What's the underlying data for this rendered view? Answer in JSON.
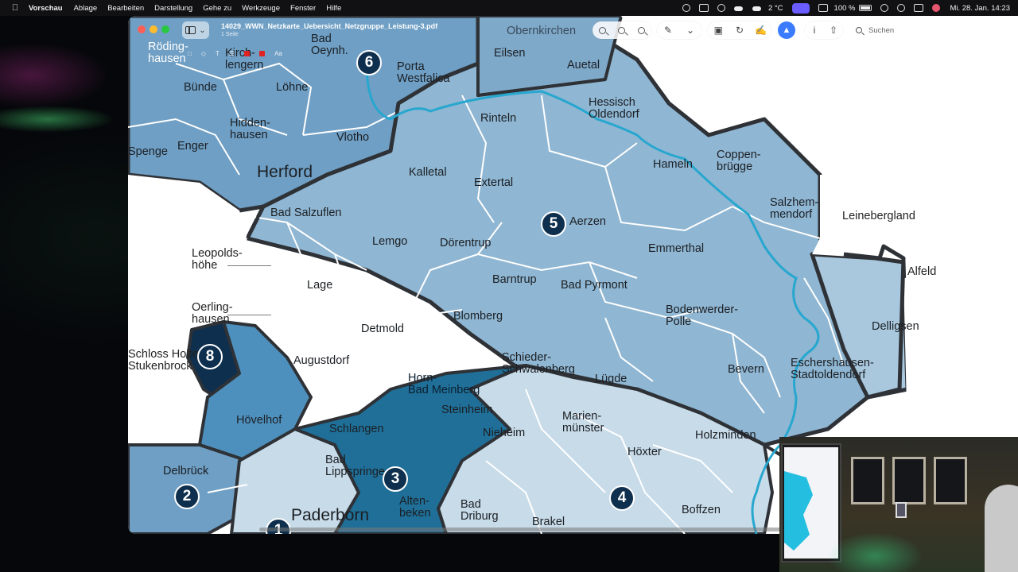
{
  "menubar": {
    "app_name": "Vorschau",
    "items": [
      "Ablage",
      "Bearbeiten",
      "Darstellung",
      "Gehe zu",
      "Werkzeuge",
      "Fenster",
      "Hilfe"
    ],
    "weather": "2 °C",
    "battery": "100 %",
    "datetime": "Mi. 28. Jan.  14:23"
  },
  "window": {
    "title": "14029_WWN_Netzkarte_Uebersicht_Netzgruppe_Leistung-3.pdf",
    "subtitle": "1 Seite",
    "search_placeholder": "Suchen",
    "mini_tool_label": "Aa"
  },
  "map": {
    "colors": {
      "group_light": "#c8dbe8",
      "group_mid": "#8fb6d2",
      "group_dark": "#6f9fc4",
      "group_deep": "#1f6f98",
      "group_navy": "#0e2f4d",
      "river": "#27a7cf",
      "border": "#2e3237"
    },
    "labels": {
      "radinghausen": "Röding-\nhausen",
      "kirchlengern": "Kirch-\nlengern",
      "bad_oeynhausen": "Bad\nOeynh.",
      "porta_westfalica": "Porta\nWestfalica",
      "eilsen": "Eilsen",
      "auetal": "Auetal",
      "obernkirchen": "Obernkirchen",
      "buende": "Bünde",
      "loehne": "Löhne",
      "hiddenhausen": "Hidden-\nhausen",
      "vlotho": "Vlotho",
      "rinteln": "Rinteln",
      "hessisch_oldendorf": "Hessisch\nOldendorf",
      "enger": "Enger",
      "spenge": "Spenge",
      "herford": "Herford",
      "kalletal": "Kalletal",
      "extertal": "Extertal",
      "hameln": "Hameln",
      "coppenbruegge": "Coppen-\nbrügge",
      "salzhemmendorf": "Salzhem-\nmendorf",
      "leinebergland": "Leinebergland",
      "bad_salzuflen": "Bad Salzuflen",
      "aerzen": "Aerzen",
      "lemgo": "Lemgo",
      "doerentrup": "Dörentrup",
      "emmerthal": "Emmerthal",
      "alfeld": "Alfeld",
      "leopoldshoehe": "Leopolds-\nhöhe",
      "lage": "Lage",
      "barntrup": "Barntrup",
      "bad_pyrmont": "Bad Pyrmont",
      "oerlinghausen": "Oerling-\nhausen",
      "detmold": "Detmold",
      "blomberg": "Blomberg",
      "bodenwerder": "Bodenwerder-\nPolle",
      "delligsen": "Delligsen",
      "schloss_holte": "Schloss Holte-\nStukenbrock",
      "augustdorf": "Augustdorf",
      "schieder": "Schieder-\nSchwalenberg",
      "luegde": "Lügde",
      "bevern": "Bevern",
      "eschershausen": "Eschershausen-\nStadtoldendorf",
      "horn": "Horn-\nBad Meinberg",
      "steinheim": "Steinheim",
      "hoevelhof": "Hövelhof",
      "schlangen": "Schlangen",
      "nieheim": "Nieheim",
      "marienmuenster": "Marien-\nmünster",
      "holzminden": "Holzminden",
      "hoexter": "Höxter",
      "bad_lippspringe": "Bad\nLippspringe",
      "delbrueck": "Delbrück",
      "paderborn": "Paderborn",
      "altenbeken": "Alten-\nbeken",
      "bad_driburg": "Bad\nDriburg",
      "brakel": "Brakel",
      "boffzen": "Boffzen"
    },
    "groups": [
      "1",
      "2",
      "3",
      "4",
      "5",
      "6",
      "8"
    ]
  }
}
